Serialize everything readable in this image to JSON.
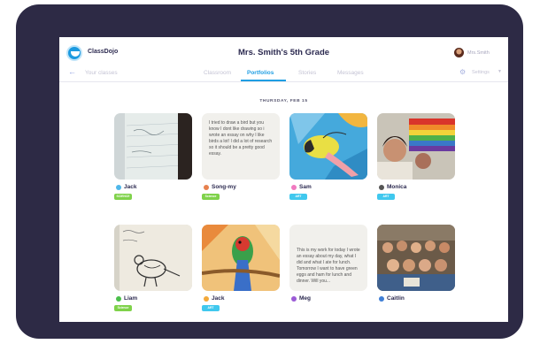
{
  "header": {
    "brand": "ClassDojo",
    "class_title": "Mrs. Smith's 5th Grade",
    "user_name": "Mrs.Smith"
  },
  "nav": {
    "back_label": "Your classes",
    "tabs": [
      "Classroom",
      "Portfolios",
      "Stories",
      "Messages"
    ],
    "active_tab": "Portfolios",
    "settings_label": "Settings"
  },
  "feed": {
    "date": "THURSDAY, FEB 15",
    "posts": [
      {
        "author": "Jack",
        "tag": "SCIENCE",
        "content": "photo: notebook with handwritten notes"
      },
      {
        "author": "Song-my",
        "tag": "Science",
        "content": "I tried to draw a bird but you know I dont like drawing so i wrote an essay on why I like birds a lot! I did a lot of research so it should be a pretty good essay."
      },
      {
        "author": "Sam",
        "tag": "ART",
        "content": "photo: colorful parrot painting"
      },
      {
        "author": "Monica",
        "tag": "ART",
        "content": "photo: student painting a rainbow mural"
      },
      {
        "author": "Liam",
        "tag": "Science",
        "content": "photo: pencil sketch of a bird with notes"
      },
      {
        "author": "Jack",
        "tag": "ART",
        "content": "photo: colorful parrot drawing"
      },
      {
        "author": "Meg",
        "tag": "",
        "content": "This is my work for today I wrote an essay about my day, what I did and what I ate for lunch. Tomorrow I want to have green eggs and ham for lunch and dinner. Will you..."
      },
      {
        "author": "Caitlin",
        "tag": "",
        "content": "photo: class group picture"
      }
    ]
  },
  "colors": {
    "frame": "#2d2a45",
    "accent": "#1f9ee3",
    "tag_science": "#7fd24a",
    "tag_art": "#40c8ee"
  }
}
